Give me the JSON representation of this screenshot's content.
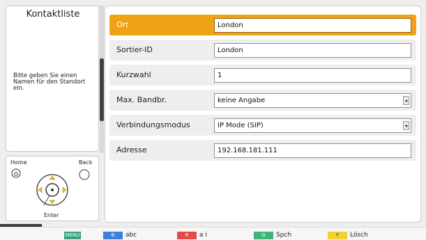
{
  "sidebar": {
    "title": "Kontaktliste",
    "help_text": "Bitte geben Sie einen Namen für den Standort ein."
  },
  "remote": {
    "home_label": "Home",
    "back_label": "Back",
    "enter_label": "Enter"
  },
  "form": {
    "rows": [
      {
        "label": "Ort",
        "value": "London",
        "type": "text",
        "selected": true
      },
      {
        "label": "Sortier-ID",
        "value": "London",
        "type": "text",
        "selected": false
      },
      {
        "label": "Kurzwahl",
        "value": "1",
        "type": "text",
        "selected": false
      },
      {
        "label": "Max. Bandbr.",
        "value": "keine Angabe",
        "type": "select",
        "selected": false
      },
      {
        "label": "Verbindungsmodus",
        "value": "IP Mode (SIP)",
        "type": "select",
        "selected": false
      },
      {
        "label": "Adresse",
        "value": "192.168.181.111",
        "type": "text",
        "selected": false
      }
    ]
  },
  "bottom_bar": {
    "menu_key": "MENU",
    "keys": [
      {
        "key": "B",
        "label": "abc",
        "color": "#3e7fd8"
      },
      {
        "key": "R",
        "label": "a i",
        "color": "#e24b4b"
      },
      {
        "key": "G",
        "label": "Spch",
        "color": "#3bb57a"
      },
      {
        "key": "Y",
        "label": "Lösch",
        "color": "#f1d232"
      }
    ],
    "menu_color": "#36a37a"
  },
  "colors": {
    "selected_row": "#f0a215",
    "row_background": "#eeeeee"
  }
}
